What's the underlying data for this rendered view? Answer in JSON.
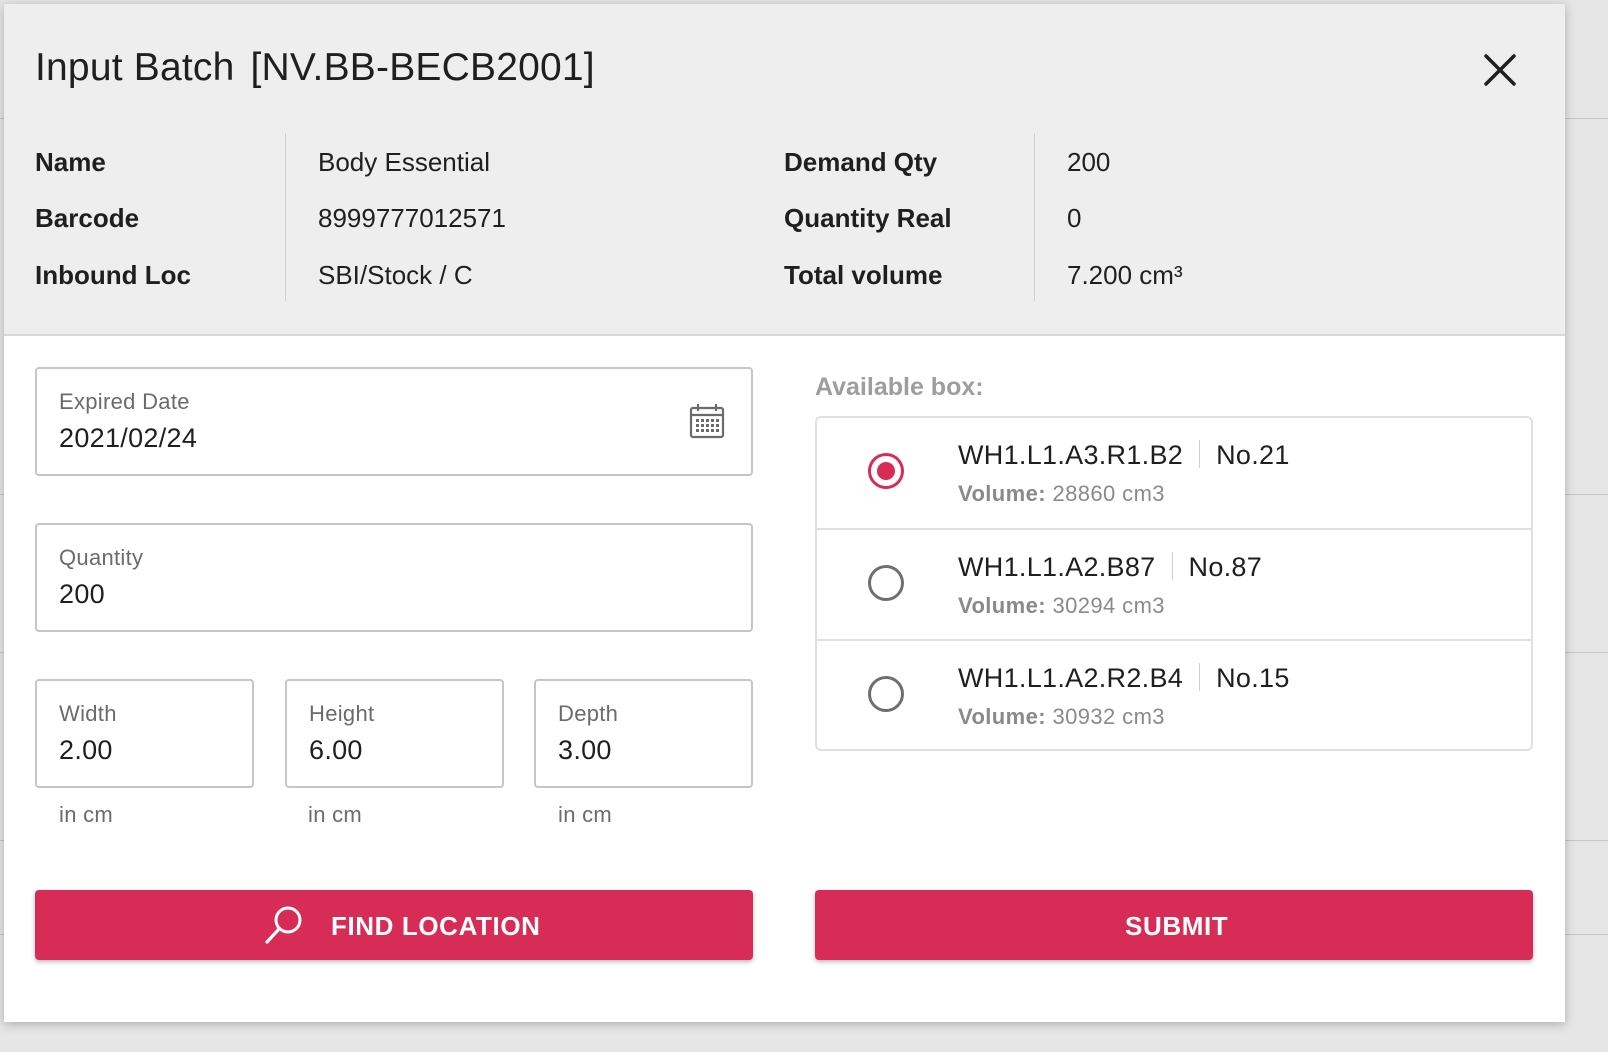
{
  "modal": {
    "title": "Input Batch",
    "batch_code": "[NV.BB-BECB2001]",
    "close_icon": "close-icon"
  },
  "info": {
    "name_label": "Name",
    "name_value": "Body Essential",
    "barcode_label": "Barcode",
    "barcode_value": "8999777012571",
    "inbound_label": "Inbound Loc",
    "inbound_value": "SBI/Stock / C",
    "demand_label": "Demand Qty",
    "demand_value": "200",
    "real_label": "Quantity Real",
    "real_value": "0",
    "volume_label": "Total volume",
    "volume_value": "7.200 cm³"
  },
  "form": {
    "expired_label": "Expired Date",
    "expired_value": "2021/02/24",
    "calendar_icon": "calendar-icon",
    "quantity_label": "Quantity",
    "quantity_value": "200",
    "width_label": "Width",
    "width_value": "2.00",
    "height_label": "Height",
    "height_value": "6.00",
    "depth_label": "Depth",
    "depth_value": "3.00",
    "unit": "in cm"
  },
  "available": {
    "title": "Available box:",
    "volume_label": "Volume:",
    "boxes": [
      {
        "code": "WH1.L1.A3.R1.B2",
        "number": "No.21",
        "volume": "28860 cm3",
        "selected": true
      },
      {
        "code": "WH1.L1.A2.B87",
        "number": "No.87",
        "volume": "30294 cm3",
        "selected": false
      },
      {
        "code": "WH1.L1.A2.R2.B4",
        "number": "No.15",
        "volume": "30932 cm3",
        "selected": false
      }
    ]
  },
  "actions": {
    "find_label": "FIND LOCATION",
    "find_icon": "search-icon",
    "submit_label": "SUBMIT"
  },
  "colors": {
    "accent": "#d72c56",
    "header_bg": "#eeeeee"
  }
}
